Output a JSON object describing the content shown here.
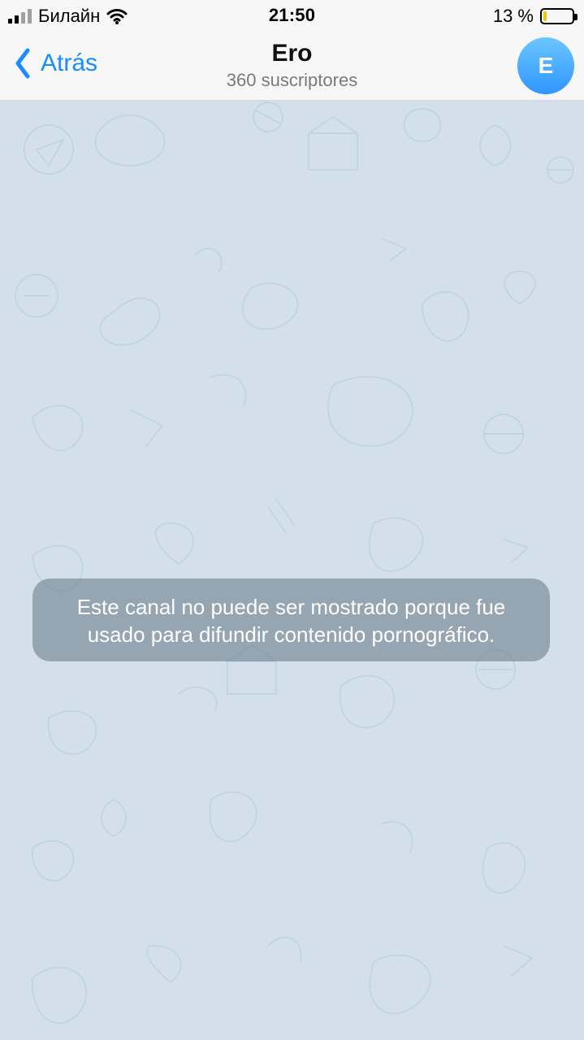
{
  "status_bar": {
    "carrier": "Билайн",
    "time": "21:50",
    "battery_percent": "13 %",
    "battery_level_fraction": 0.13
  },
  "nav": {
    "back_label": "Atrás",
    "title": "Ero",
    "subtitle": "360 suscriptores",
    "avatar_initial": "E",
    "avatar_colors": {
      "top": "#6cc6ff",
      "bottom": "#2f96ff"
    }
  },
  "chat": {
    "background_color": "#d3e0ec",
    "notice_text": "Este canal no puede ser mostrado porque fue usado para difundir contenido pornográfico."
  },
  "icons": {
    "back": "chevron-left-icon",
    "signal": "cellular-signal-icon",
    "wifi": "wifi-icon",
    "battery": "battery-icon"
  },
  "accent_color": "#1a8cff"
}
